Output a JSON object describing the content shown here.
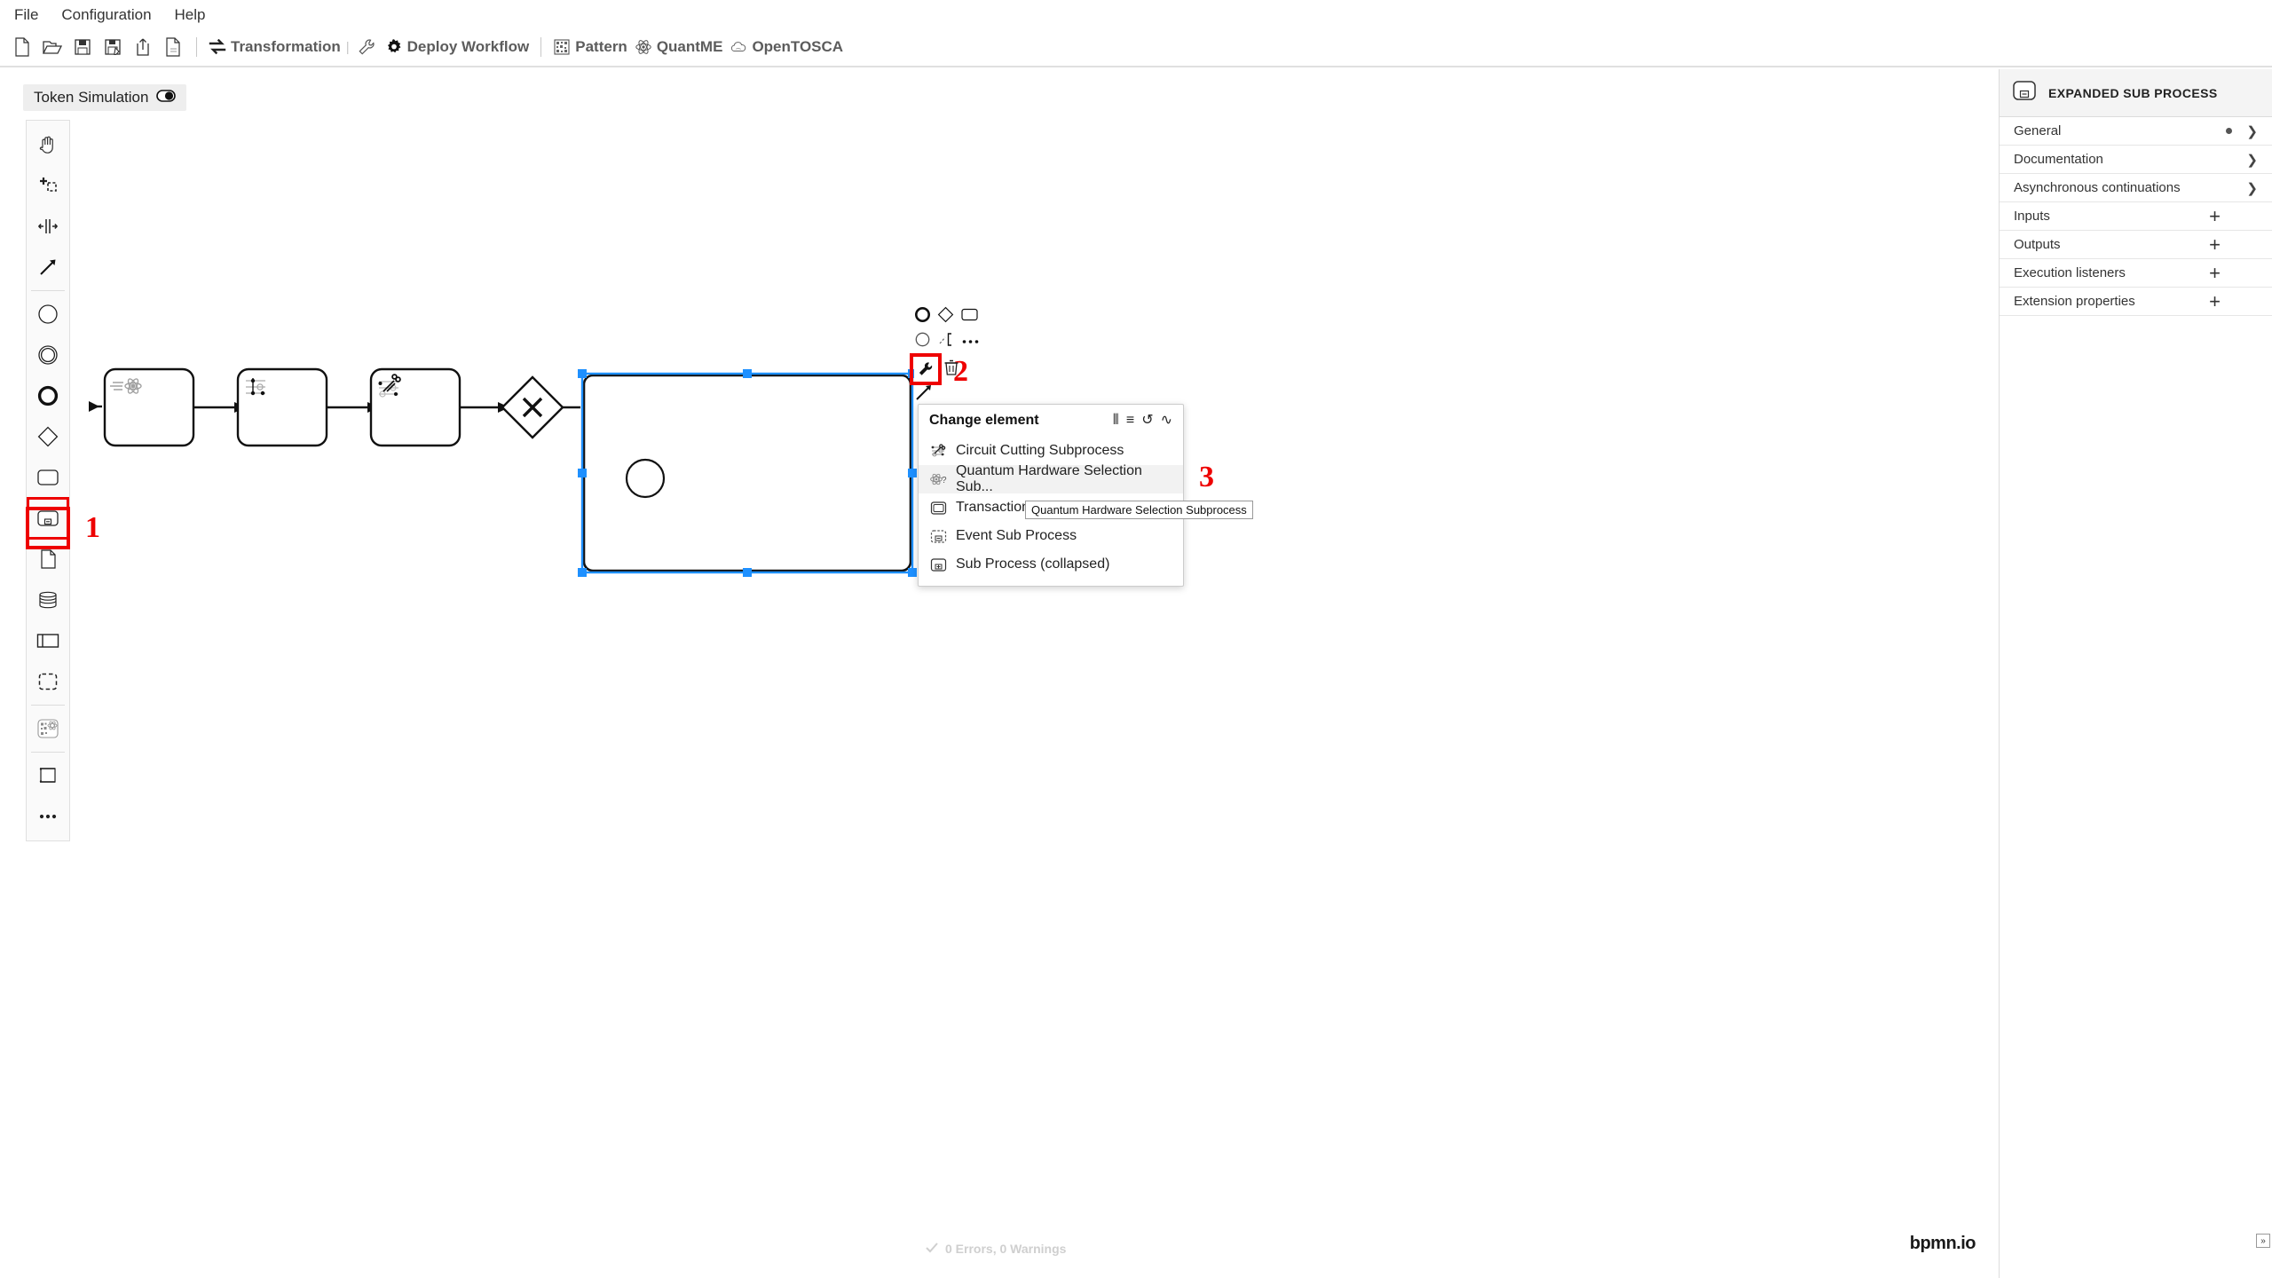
{
  "menubar": {
    "items": [
      {
        "label": "File",
        "name": "menu-file"
      },
      {
        "label": "Configuration",
        "name": "menu-configuration"
      },
      {
        "label": "Help",
        "name": "menu-help"
      }
    ]
  },
  "toolbar": {
    "icon_buttons": [
      {
        "name": "new-file-icon",
        "title": "New"
      },
      {
        "name": "open-folder-icon",
        "title": "Open"
      },
      {
        "name": "save-icon",
        "title": "Save"
      },
      {
        "name": "save-as-icon",
        "title": "Save As"
      },
      {
        "name": "export-icon",
        "title": "Export"
      },
      {
        "name": "new-diagram-icon",
        "title": "New Diagram"
      }
    ],
    "groups": [
      {
        "label": "Transformation",
        "icon": "transformation-icon",
        "name": "toolbar-transformation"
      },
      {
        "label": "Deploy Workflow",
        "icon": "gear-icon",
        "name": "toolbar-deploy-workflow"
      },
      {
        "label": "Pattern",
        "icon": "pattern-icon",
        "name": "toolbar-pattern"
      },
      {
        "label": "QuantME",
        "icon": "atom-icon",
        "name": "toolbar-quantme"
      },
      {
        "label": "OpenTOSCA",
        "icon": "cloud-icon",
        "name": "toolbar-opentosca"
      }
    ],
    "wrench_icon": "wrench-icon"
  },
  "token_simulation": {
    "label": "Token Simulation",
    "toggle_icon": "toggle-off-icon"
  },
  "palette": {
    "items": [
      {
        "name": "palette-hand-tool",
        "icon": "hand-icon",
        "title": "Activate the hand tool"
      },
      {
        "name": "palette-lasso-tool",
        "icon": "lasso-icon",
        "title": "Activate the lasso tool"
      },
      {
        "name": "palette-space-tool",
        "icon": "space-tool-icon",
        "title": "Activate the create/remove space tool"
      },
      {
        "name": "palette-connect-tool",
        "icon": "arrow-icon",
        "title": "Activate the global connect tool"
      },
      {
        "name": "palette-start-event",
        "icon": "circle-thin-icon",
        "title": "Create StartEvent"
      },
      {
        "name": "palette-intermediate-event",
        "icon": "double-circle-icon",
        "title": "Create Intermediate/Boundary Event"
      },
      {
        "name": "palette-end-event",
        "icon": "circle-thick-icon",
        "title": "Create EndEvent"
      },
      {
        "name": "palette-gateway",
        "icon": "diamond-icon",
        "title": "Create Gateway"
      },
      {
        "name": "palette-task",
        "icon": "rounded-rect-icon",
        "title": "Create Task"
      },
      {
        "name": "palette-expanded-subprocess",
        "icon": "expanded-subprocess-icon",
        "title": "Create expanded SubProcess"
      },
      {
        "name": "palette-data-object",
        "icon": "data-object-icon",
        "title": "Create DataObjectReference"
      },
      {
        "name": "palette-data-store",
        "icon": "data-store-icon",
        "title": "Create DataStoreReference"
      },
      {
        "name": "palette-participant",
        "icon": "participant-icon",
        "title": "Create Pool/Participant"
      },
      {
        "name": "palette-group",
        "icon": "group-dashed-icon",
        "title": "Create Group"
      },
      {
        "name": "palette-quantme",
        "icon": "quantme-icon",
        "title": "QuantME Constructs"
      },
      {
        "name": "palette-pattern",
        "icon": "pattern-scroll-icon",
        "title": "Patterns"
      },
      {
        "name": "palette-more",
        "icon": "ellipsis-icon",
        "title": "More"
      }
    ],
    "highlighted_index": 9
  },
  "diagram": {
    "tasks": [
      {
        "name": "task-quantum-circuit-loading",
        "icon": "quantum-loading-icon"
      },
      {
        "name": "task-quantum-circuit-execution",
        "icon": "quantum-circuit-icon"
      },
      {
        "name": "task-circuit-cutting",
        "icon": "scissors-circuit-icon"
      }
    ],
    "gateway": {
      "name": "exclusive-gateway",
      "marker": "X"
    },
    "subprocess": {
      "name": "expanded-subprocess-shape",
      "selected": true,
      "inner_event": "start-event-circle"
    }
  },
  "context_pad": {
    "items": [
      {
        "name": "append-end-event-icon",
        "icon": "circle-thick-icon"
      },
      {
        "name": "append-gateway-icon",
        "icon": "diamond-icon"
      },
      {
        "name": "append-task-icon",
        "icon": "rounded-rect-icon"
      },
      {
        "name": "append-intermediate-event-icon",
        "icon": "circle-thin-icon"
      },
      {
        "name": "append-text-annotation-icon",
        "icon": "annotation-icon"
      },
      {
        "name": "more-options-icon",
        "icon": "ellipsis-icon"
      },
      {
        "name": "change-element-wrench-icon",
        "icon": "wrench-icon"
      },
      {
        "name": "delete-icon",
        "icon": "trash-icon"
      },
      {
        "name": "connect-icon",
        "icon": "arrow-icon"
      }
    ],
    "highlighted": "change-element-wrench-icon"
  },
  "change_element_popup": {
    "title": "Change element",
    "header_icons": [
      {
        "name": "columns-icon",
        "glyph": "⦀"
      },
      {
        "name": "list-icon",
        "glyph": "≡"
      },
      {
        "name": "loop-icon",
        "glyph": "↺"
      },
      {
        "name": "wave-icon",
        "glyph": "∿"
      }
    ],
    "items": [
      {
        "label": "Circuit Cutting Subprocess",
        "name": "popup-item-circuit-cutting-subprocess",
        "icon": "circuit-cutting-icon",
        "selected": false
      },
      {
        "label": "Quantum Hardware Selection Sub...",
        "name": "popup-item-quantum-hardware-selection-subprocess",
        "icon": "quantum-hardware-icon",
        "selected": true
      },
      {
        "label": "Transaction",
        "name": "popup-item-transaction",
        "icon": "transaction-icon",
        "selected": false
      },
      {
        "label": "Event Sub Process",
        "name": "popup-item-event-sub-process",
        "icon": "event-subprocess-icon",
        "selected": false
      },
      {
        "label": "Sub Process (collapsed)",
        "name": "popup-item-sub-process-collapsed",
        "icon": "collapsed-subprocess-icon",
        "selected": false
      }
    ]
  },
  "tooltip": {
    "text": "Quantum Hardware Selection Subprocess"
  },
  "annotations": [
    {
      "number": "1",
      "name": "annotation-1"
    },
    {
      "number": "2",
      "name": "annotation-2"
    },
    {
      "number": "3",
      "name": "annotation-3"
    }
  ],
  "properties_panel": {
    "header": {
      "title": "EXPANDED SUB PROCESS",
      "icon": "expanded-subprocess-icon"
    },
    "rows": [
      {
        "label": "General",
        "name": "prop-row-general",
        "control": "chevron",
        "dot": true
      },
      {
        "label": "Documentation",
        "name": "prop-row-documentation",
        "control": "chevron",
        "dot": false
      },
      {
        "label": "Asynchronous continuations",
        "name": "prop-row-asynchronous-continuations",
        "control": "chevron",
        "dot": false
      },
      {
        "label": "Inputs",
        "name": "prop-row-inputs",
        "control": "plus",
        "dot": false
      },
      {
        "label": "Outputs",
        "name": "prop-row-outputs",
        "control": "plus",
        "dot": false
      },
      {
        "label": "Execution listeners",
        "name": "prop-row-execution-listeners",
        "control": "plus",
        "dot": false
      },
      {
        "label": "Extension properties",
        "name": "prop-row-extension-properties",
        "control": "plus",
        "dot": false
      }
    ]
  },
  "footer": {
    "status": "0 Errors, 0 Warnings",
    "status_icon": "check-icon",
    "logo": "bpmn.io",
    "collapse_glyph": "»"
  },
  "colors": {
    "accent_red": "#ee0000",
    "selection_blue": "#1e90ff",
    "panel_bg": "#f4f4f4",
    "toolbar_text": "#5c5c5c"
  }
}
